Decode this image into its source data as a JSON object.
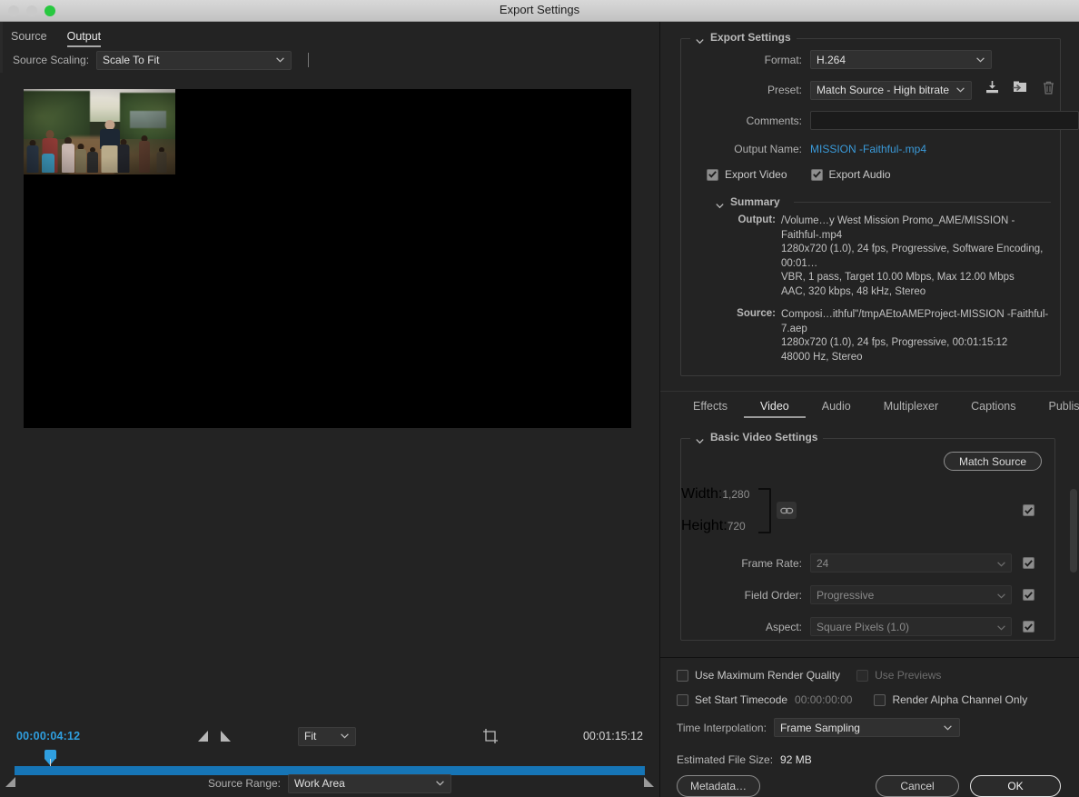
{
  "window": {
    "title": "Export Settings",
    "traffic_lights": [
      "close-button",
      "minimize-button",
      "zoom-button"
    ]
  },
  "left_panel": {
    "tabs": [
      {
        "label": "Source",
        "active": false
      },
      {
        "label": "Output",
        "active": true
      }
    ],
    "source_scaling": {
      "label": "Source Scaling:",
      "value": "Scale To Fit"
    },
    "transport": {
      "current_timecode": "00:00:04:12",
      "duration_timecode": "00:01:15:12",
      "zoom_level": "Fit",
      "mark_in_icon": "mark-in-icon",
      "mark_out_icon": "mark-out-icon",
      "crop_icon": "crop-aspect-icon"
    },
    "source_range": {
      "label": "Source Range:",
      "value": "Work Area"
    }
  },
  "export_settings": {
    "group_title": "Export Settings",
    "format": {
      "label": "Format:",
      "value": "H.264"
    },
    "preset": {
      "label": "Preset:",
      "value": "Match Source - High bitrate",
      "icons": [
        "import-preset-icon",
        "export-preset-icon",
        "delete-preset-icon"
      ]
    },
    "comments": {
      "label": "Comments:",
      "value": "",
      "placeholder": ""
    },
    "output_name": {
      "label": "Output Name:",
      "value": "MISSION -Faithful-.mp4"
    },
    "export_video": {
      "label": "Export Video",
      "checked": true
    },
    "export_audio": {
      "label": "Export Audio",
      "checked": true
    },
    "summary": {
      "title": "Summary",
      "output_key": "Output:",
      "output_lines": [
        "/Volume…y West Mission Promo_AME/MISSION -Faithful-.mp4",
        "1280x720 (1.0), 24 fps, Progressive, Software Encoding, 00:01…",
        "VBR, 1 pass, Target 10.00 Mbps, Max 12.00 Mbps",
        "AAC, 320 kbps, 48 kHz, Stereo"
      ],
      "source_key": "Source:",
      "source_lines": [
        "Composi…ithful\"/tmpAEtoAMEProject-MISSION -Faithful-7.aep",
        "1280x720 (1.0), 24 fps, Progressive, 00:01:15:12",
        "48000 Hz, Stereo"
      ]
    }
  },
  "tabs": [
    {
      "label": "Effects",
      "active": false
    },
    {
      "label": "Video",
      "active": true
    },
    {
      "label": "Audio",
      "active": false
    },
    {
      "label": "Multiplexer",
      "active": false
    },
    {
      "label": "Captions",
      "active": false
    },
    {
      "label": "Publish",
      "active": false
    }
  ],
  "video_tab": {
    "group_title": "Basic Video Settings",
    "match_source_button": "Match Source",
    "link_icon": "link-chain-icon",
    "width": {
      "label": "Width:",
      "value": "1,280",
      "checked": true
    },
    "height": {
      "label": "Height:",
      "value": "720"
    },
    "frame_rate": {
      "label": "Frame Rate:",
      "value": "24",
      "checked": true
    },
    "field_order": {
      "label": "Field Order:",
      "value": "Progressive",
      "checked": true
    },
    "aspect": {
      "label": "Aspect:",
      "value": "Square Pixels (1.0)",
      "checked": true
    }
  },
  "bottom": {
    "use_max_render_quality": {
      "label": "Use Maximum Render Quality",
      "checked": false
    },
    "use_previews": {
      "label": "Use Previews",
      "checked": false,
      "disabled": true
    },
    "set_start_timecode": {
      "label": "Set Start Timecode",
      "checked": false,
      "value": "00:00:00:00"
    },
    "render_alpha_only": {
      "label": "Render Alpha Channel Only",
      "checked": false
    },
    "time_interpolation": {
      "label": "Time Interpolation:",
      "value": "Frame Sampling"
    },
    "estimated_file_size": {
      "label": "Estimated File Size:",
      "value": "92 MB"
    },
    "metadata_button": "Metadata…",
    "cancel_button": "Cancel",
    "ok_button": "OK"
  },
  "colors": {
    "accent_blue": "#2f9fe0",
    "link_blue": "#3a9ad9",
    "panel_bg": "#232323",
    "titlebar": "#cfcfcf"
  }
}
